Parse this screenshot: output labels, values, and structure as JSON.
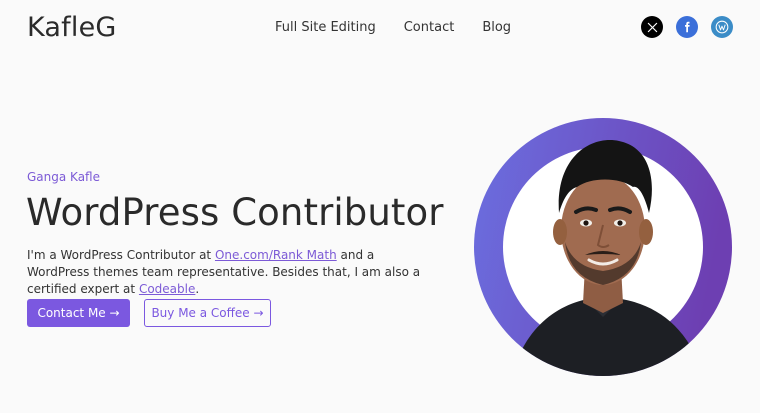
{
  "header": {
    "logo": "KafleG",
    "nav": [
      {
        "label": "Full Site Editing"
      },
      {
        "label": "Contact"
      },
      {
        "label": "Blog"
      }
    ],
    "social": [
      {
        "icon": "x-icon"
      },
      {
        "icon": "facebook-icon"
      },
      {
        "icon": "wordpress-icon"
      }
    ]
  },
  "hero": {
    "kicker": "Ganga Kafle",
    "headline": "WordPress Contributor",
    "bio": {
      "part1": "I'm a WordPress Contributor at ",
      "link1": "One.com/Rank Math",
      "part2": " and a WordPress themes team representative. Besides that, I am also a certified expert at ",
      "link2": "Codeable",
      "part3": "."
    },
    "buttons": {
      "primary": "Contact Me →",
      "secondary": "Buy Me a Coffee →"
    }
  },
  "colors": {
    "accent": "#7b58e0",
    "ring_start": "#6b6fe0",
    "ring_end": "#6d3fb2"
  }
}
